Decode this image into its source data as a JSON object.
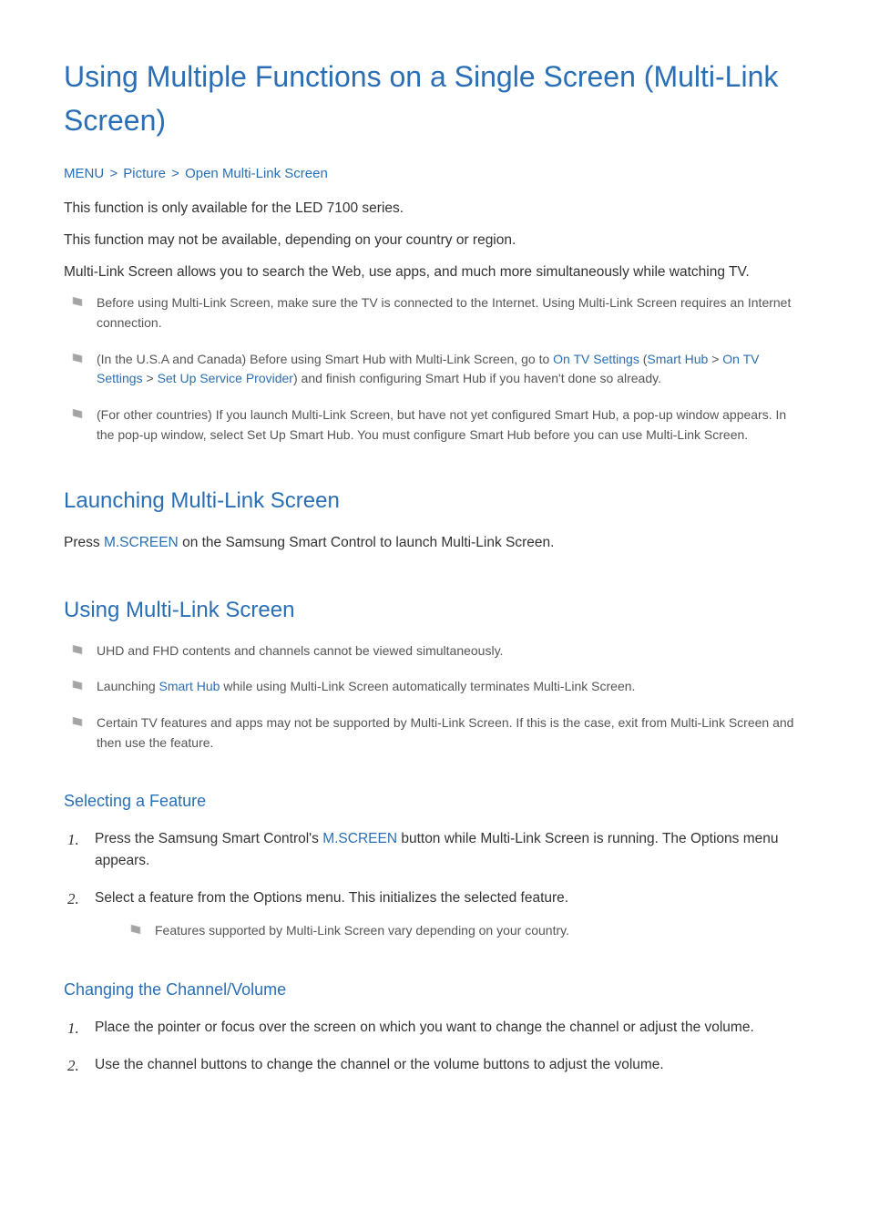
{
  "title": "Using Multiple Functions on a Single Screen (Multi-Link Screen)",
  "breadcrumb": {
    "items": [
      "MENU",
      "Picture",
      "Open Multi-Link Screen"
    ]
  },
  "intro": {
    "p1": "This function is only available for the LED 7100 series.",
    "p2": "This function may not be available, depending on your country or region.",
    "p3": "Multi-Link Screen allows you to search the Web, use apps, and much more simultaneously while watching TV."
  },
  "intro_notes": [
    {
      "text": "Before using Multi-Link Screen, make sure the TV is connected to the Internet. Using Multi-Link Screen requires an Internet connection."
    },
    {
      "prefix": "(In the U.S.A and Canada) Before using Smart Hub with Multi-Link Screen, go to ",
      "kw1": "On TV Settings",
      "paren_open": " (",
      "kw2": "Smart Hub",
      "sep1": " > ",
      "kw3": "On TV Settings",
      "sep2": " > ",
      "kw4": "Set Up Service Provider",
      "paren_close": ")",
      "suffix": " and finish configuring Smart Hub if you haven't done so already."
    },
    {
      "text": "(For other countries) If you launch Multi-Link Screen, but have not yet configured Smart Hub, a pop-up window appears. In the pop-up window, select Set Up Smart Hub. You must configure Smart Hub before you can use Multi-Link Screen."
    }
  ],
  "section_launching": {
    "heading": "Launching Multi-Link Screen",
    "para_prefix": "Press ",
    "para_kw": "M.SCREEN",
    "para_suffix": " on the Samsung Smart Control to launch Multi-Link Screen."
  },
  "section_using": {
    "heading": "Using Multi-Link Screen",
    "notes": [
      {
        "text": "UHD and FHD contents and channels cannot be viewed simultaneously."
      },
      {
        "prefix": "Launching ",
        "kw": "Smart Hub",
        "suffix": " while using Multi-Link Screen automatically terminates Multi-Link Screen."
      },
      {
        "text": "Certain TV features and apps may not be supported by Multi-Link Screen. If this is the case, exit from Multi-Link Screen and then use the feature."
      }
    ]
  },
  "section_selecting": {
    "heading": "Selecting a Feature",
    "steps": [
      {
        "prefix": "Press the Samsung Smart Control's ",
        "kw": "M.SCREEN",
        "suffix": " button while Multi-Link Screen is running. The Options menu appears."
      },
      {
        "text": "Select a feature from the Options menu. This initializes the selected feature."
      }
    ],
    "sub_note": "Features supported by Multi-Link Screen vary depending on your country."
  },
  "section_changing": {
    "heading": "Changing the Channel/Volume",
    "steps": [
      "Place the pointer or focus over the screen on which you want to change the channel or adjust the volume.",
      "Use the channel buttons to change the channel or the volume buttons to adjust the volume."
    ]
  }
}
